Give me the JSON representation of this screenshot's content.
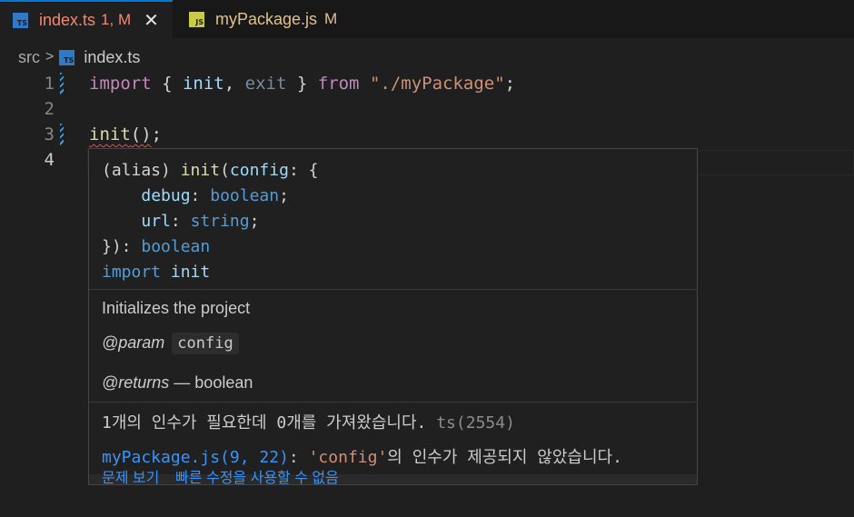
{
  "tabs": [
    {
      "icon": "TS",
      "name": "index.ts",
      "badge": "1, M",
      "close": "✕"
    },
    {
      "icon": "JS",
      "name": "myPackage.js",
      "badge": "M"
    }
  ],
  "breadcrumb": {
    "folder": "src",
    "separator": ">",
    "icon": "TS",
    "file": "index.ts"
  },
  "editor": {
    "lines": [
      {
        "number": "1",
        "tokens": {
          "import": "import",
          "open": " { ",
          "init": "init",
          "comma": ", ",
          "exit": "exit",
          "close": " } ",
          "from": "from",
          "space": " ",
          "path": "\"./myPackage\"",
          "semi": ";"
        }
      },
      {
        "number": "2"
      },
      {
        "number": "3",
        "tokens": {
          "call": "init",
          "parens": "()",
          "semi": ";"
        }
      },
      {
        "number": "4"
      }
    ]
  },
  "hover": {
    "signature": {
      "l1_a": "(alias) ",
      "l1_fn": "init",
      "l1_b": "(",
      "l1_param": "config",
      ":": ": {",
      "l2_indent": "    ",
      "l2_key": "debug",
      ": ": ": ",
      "l2_type": "boolean",
      "l2_semi": ";",
      "l3_indent": "    ",
      "l3_key": "url",
      "l3_colon": ": ",
      "l3_type": "string",
      "l3_semi": ";",
      "l4_a": "}): ",
      "l4_type": "boolean",
      "l5_kw": "import",
      "l5_sp": " ",
      "l5_name": "init"
    },
    "description": "Initializes the project",
    "param_tag": "@param",
    "param_name": "config",
    "returns_tag": "@returns",
    "returns_text": " — boolean",
    "error_message": "1개의 인수가 필요한데 0개를 가져왔습니다. ",
    "error_code": "ts(2554)",
    "related_link": "myPackage.js(9, 22)",
    "related_colon": ": ",
    "related_quote": "'config'",
    "related_rest": "의 인수가 제공되지 않았습니다.",
    "quick_fix": "문제 보기    빠른 수정을 사용할 수 없음"
  },
  "colors": {
    "accent": "#0078d4",
    "error": "#f48771",
    "modified": "#e2c08d",
    "link": "#3794ff"
  }
}
